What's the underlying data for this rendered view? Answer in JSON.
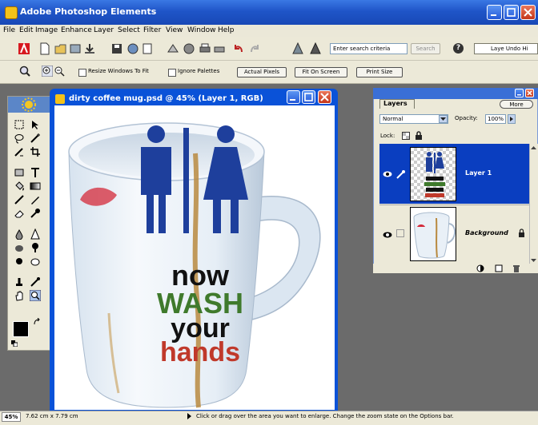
{
  "app": {
    "title": "Adobe Photoshop Elements"
  },
  "menu": [
    "File",
    "Edit",
    "Image",
    "Enhance",
    "Layer",
    "Select",
    "Filter",
    "View",
    "Window",
    "Help"
  ],
  "toolbar": {
    "search_value": "Enter search criteria",
    "search_button": "Search",
    "help_icon": "?",
    "palette_well_text": "Laye Undo Hi"
  },
  "options": {
    "resize_windows": "Resize Windows To Fit",
    "ignore_palettes": "Ignore Palettes",
    "actual_pixels": "Actual Pixels",
    "fit_on_screen": "Fit On Screen",
    "print_size": "Print Size"
  },
  "document": {
    "title": "dirty coffee mug.psd @ 45% (Layer 1, RGB)",
    "poster_lines": [
      "now",
      "WASH",
      "your",
      "hands"
    ]
  },
  "layers_palette": {
    "tab": "Layers",
    "more_button": "More",
    "blend_mode": "Normal",
    "opacity_label": "Opacity:",
    "opacity_value": "100%",
    "lock_label": "Lock:",
    "layers": [
      {
        "name": "Layer 1",
        "selected": true
      },
      {
        "name": "Background",
        "selected": false
      }
    ]
  },
  "status": {
    "zoom": "45%",
    "doc_size": "7.62 cm x 7.79 cm",
    "message": "Click or drag over the area you want to enlarge. Change the zoom state on the Options bar."
  },
  "colors": {
    "title_blue": "#1f55c8",
    "figure_blue": "#1e3f9c",
    "wash_green": "#3f7a2c",
    "hands_red": "#c0392b",
    "layer_selected": "#0a3ec0"
  }
}
